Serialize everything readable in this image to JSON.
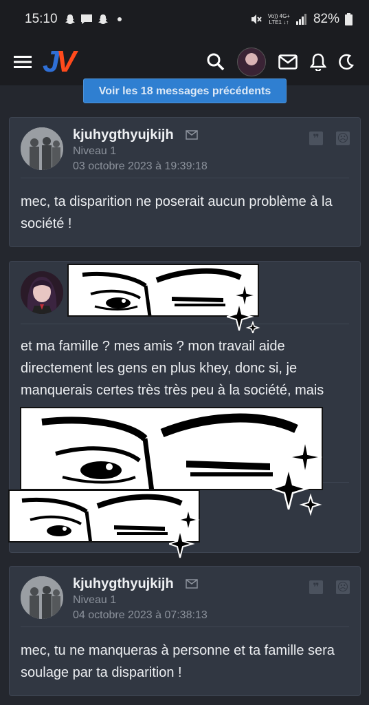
{
  "status_bar": {
    "time": "15:10",
    "net_top": "Vo)) 4G+",
    "net_bottom": "LTE1 ↓↑",
    "battery": "82%"
  },
  "nav": {
    "logo_j": "J",
    "logo_v": "V"
  },
  "prev_button": "Voir les 18 messages précédents",
  "posts": [
    {
      "author": "kjuhygthyujkijh",
      "level": "Niveau 1",
      "date": "03 octobre 2023 à 19:39:18",
      "body": "mec, ta disparition ne poserait aucun problème à la société !"
    },
    {
      "body": "et ma famille ? mes amis ? mon travail aide directement les gens en plus khey, donc si, je manquerais certes très très peu à la société, mais"
    },
    {
      "author": "kjuhygthyujkijh",
      "level": "Niveau 1",
      "date": "04 octobre 2023 à 07:38:13",
      "body": "mec, tu ne manqueras à personne et ta famille sera soulage par ta disparition !"
    }
  ],
  "colors": {
    "background": "#24272e",
    "card": "#313742",
    "button": "#2f7fd1",
    "logo_blue": "#2f6fd6",
    "logo_red": "#ff4a1c"
  }
}
